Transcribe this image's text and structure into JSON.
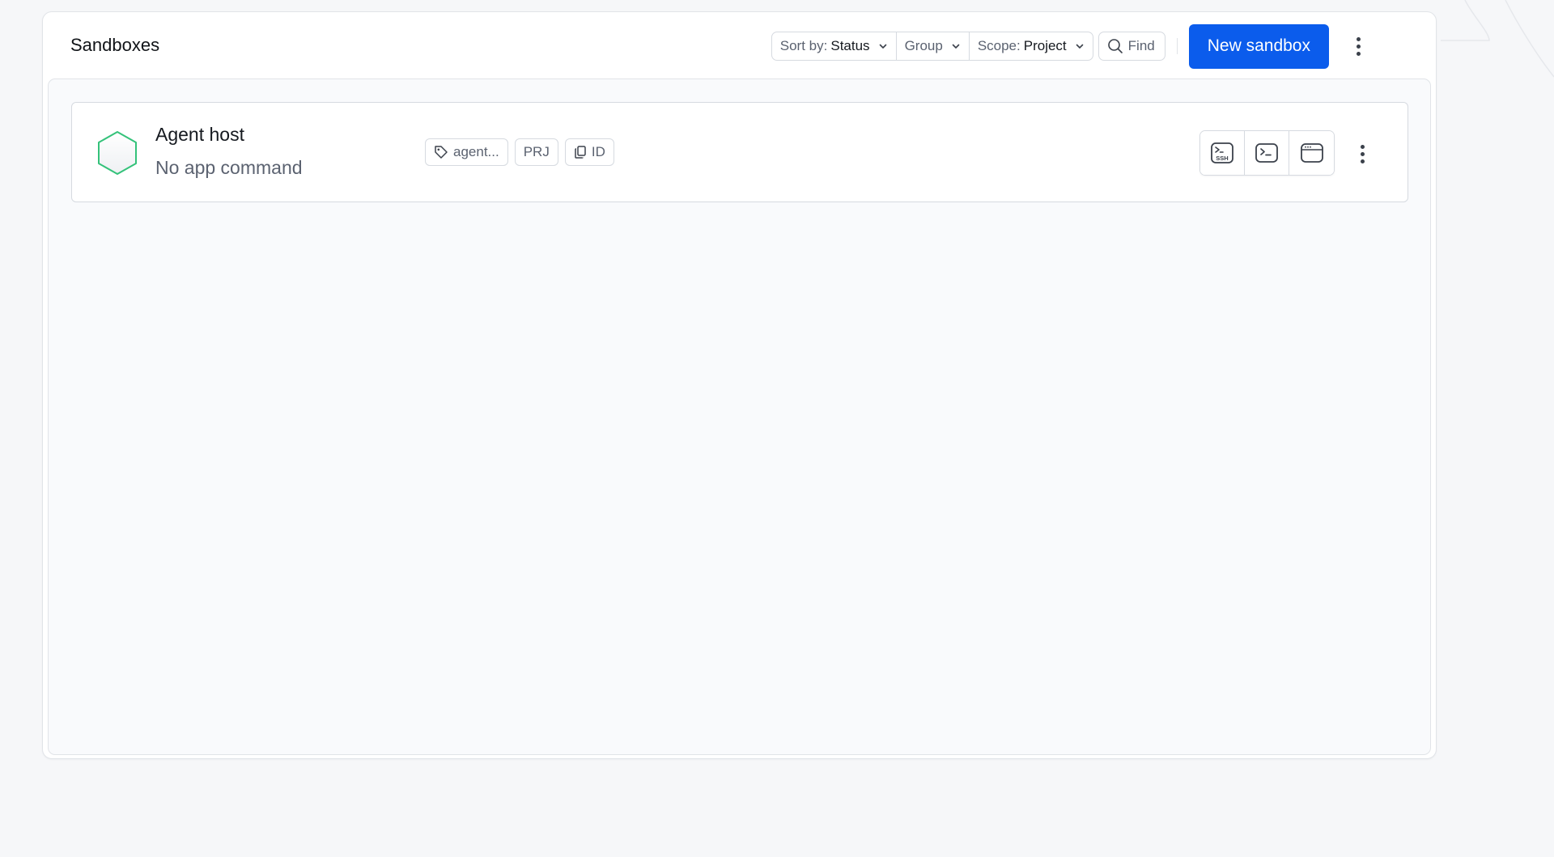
{
  "header": {
    "title": "Sandboxes",
    "sort_label": "Sort by:",
    "sort_value": "Status",
    "group_label": "Group",
    "scope_label": "Scope:",
    "scope_value": "Project",
    "find_label": "Find",
    "new_button": "New sandbox"
  },
  "sandboxes": [
    {
      "name": "Agent host",
      "subtitle": "No app command",
      "status_color": "#34c27a",
      "chips": [
        {
          "label": "agent...",
          "icon": "tag-icon"
        },
        {
          "label": "PRJ"
        },
        {
          "label": "ID",
          "icon": "copy-icon"
        }
      ],
      "actions": [
        "ssh-icon",
        "terminal-icon",
        "browser-window-icon"
      ]
    }
  ],
  "colors": {
    "accent": "#0b5cec",
    "status_running": "#34c27a"
  }
}
